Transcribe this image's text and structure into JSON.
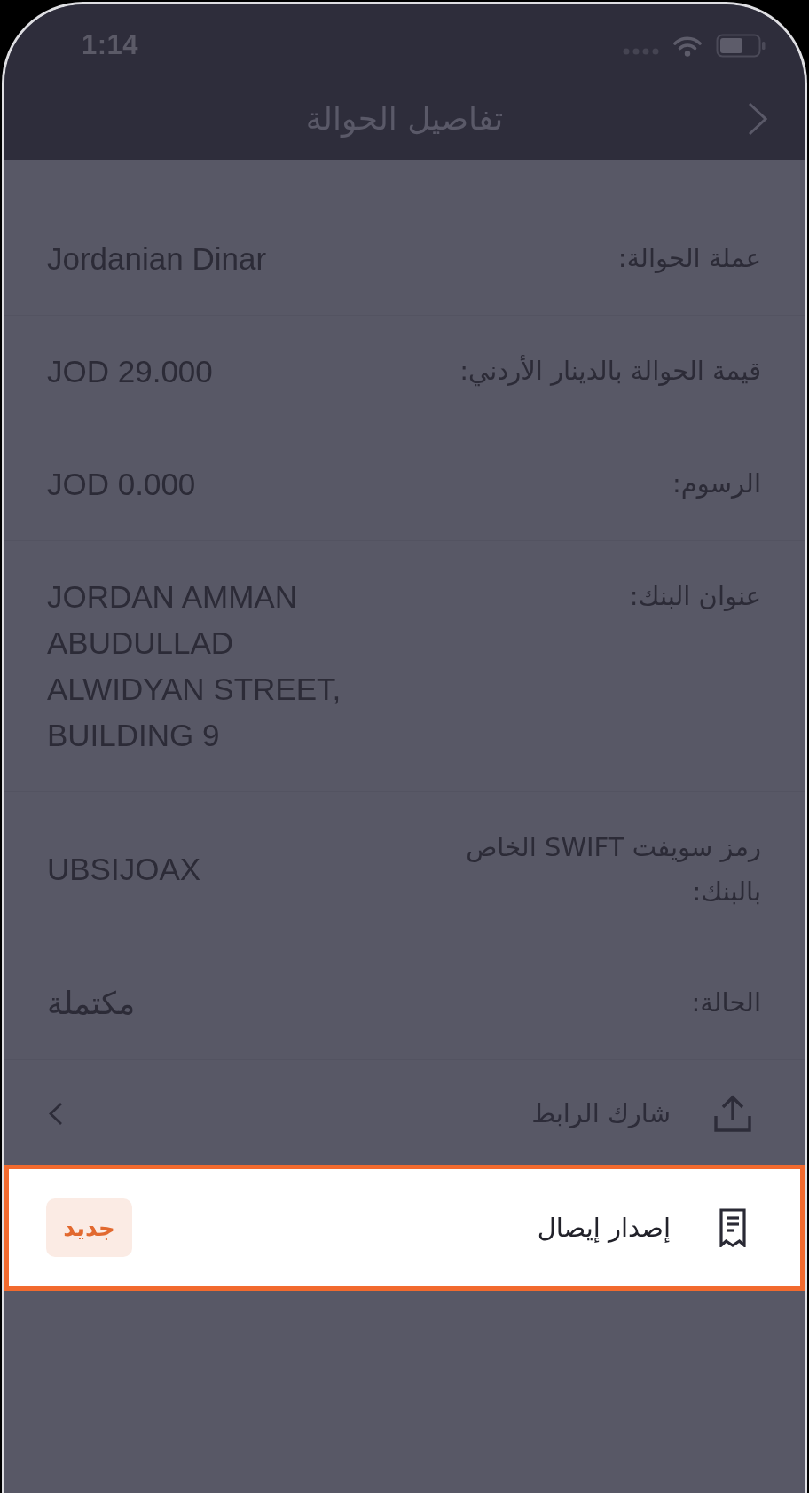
{
  "status_bar": {
    "time": "1:14"
  },
  "nav_bar": {
    "title": "تفاصيل الحوالة"
  },
  "details": [
    {
      "label": "عملة الحوالة:",
      "value": "Jordanian Dinar"
    },
    {
      "label": "قيمة الحوالة بالدينار الأردني:",
      "value": "JOD 29.000"
    },
    {
      "label": "الرسوم:",
      "value": "JOD 0.000"
    },
    {
      "label": "عنوان البنك:",
      "value": "JORDAN AMMAN ABUDULLAD ALWIDYAN STREET, BUILDING 9"
    },
    {
      "label": "رمز سويفت SWIFT الخاص بالبنك:",
      "value": "UBSIJOAX"
    },
    {
      "label": "الحالة:",
      "value": "مكتملة"
    }
  ],
  "actions": [
    {
      "kind": "share",
      "label": "شارك الرابط",
      "highlighted": false
    },
    {
      "kind": "receipt",
      "label": "إصدار إيصال",
      "highlighted": true,
      "badge": "جديد"
    }
  ]
}
